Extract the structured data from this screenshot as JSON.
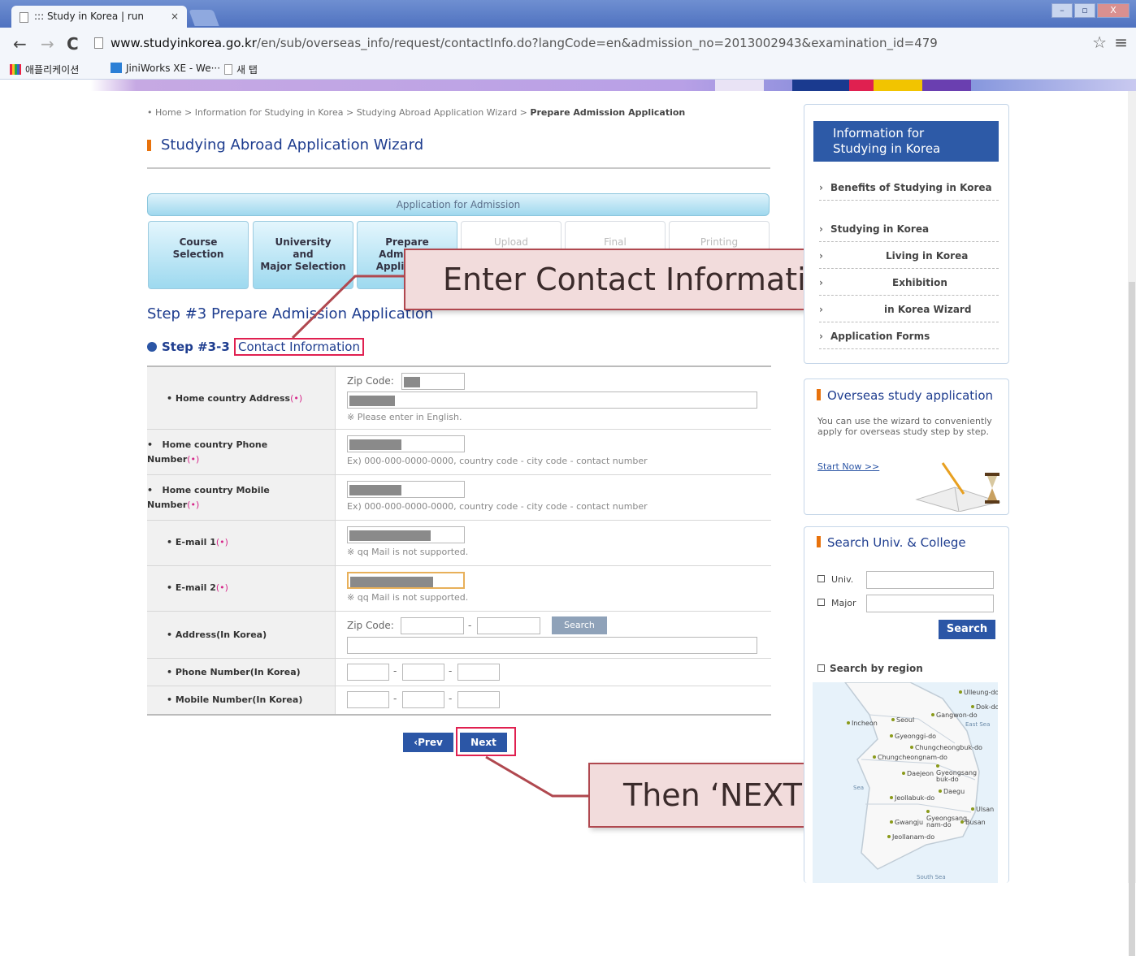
{
  "browser": {
    "tab_title": "::: Study in Korea | run",
    "tab_close": "×",
    "url_domain": "www.studyinkorea.go.kr",
    "url_path": "/en/sub/overseas_info/request/contactInfo.do?langCode=en&admission_no=2013002943&examination_id=479",
    "bookmarks": [
      "애플리케이션",
      "JiniWorks XE - We···",
      "새 탭"
    ],
    "minimize": "–",
    "maximize": "▫",
    "close": "X"
  },
  "breadcrumb": {
    "items": [
      "Home",
      "Information for Studying in Korea",
      "Studying Abroad Application Wizard"
    ],
    "current": "Prepare Admission Application"
  },
  "page_title": "Studying Abroad Application Wizard",
  "wizard": {
    "bar_label": "Application for Admission",
    "steps": [
      {
        "label": "Course\nSelection",
        "active": true
      },
      {
        "label": "University\nand\nMajor Selection",
        "active": true
      },
      {
        "label": "Prepare\nAdmission\nApplication",
        "active": true
      },
      {
        "label": "Upload",
        "active": false
      },
      {
        "label": "Final",
        "active": false
      },
      {
        "label": "Printing",
        "active": false
      }
    ]
  },
  "step_heading": "Step #3 Prepare Admission Application",
  "substep": {
    "prefix": "Step #3-3",
    "highlight": "Contact Information"
  },
  "form": {
    "home_address_label": "Home country Address",
    "req_mark": "(•)",
    "zip_code_label": "Zip Code:",
    "english_hint": "※ Please enter in English.",
    "home_phone_label": "Home country Phone Number",
    "home_mobile_label": "Home country Mobile Number",
    "phone_hint": "Ex) 000-000-0000-0000, country code - city code - contact number",
    "email1_label": "E-mail 1",
    "email2_label": "E-mail 2",
    "qq_hint": "※ qq Mail is not supported.",
    "korea_address_label": "Address(In Korea)",
    "search_label": "Search",
    "korea_phone_label": "Phone Number(In Korea)",
    "korea_mobile_label": "Mobile Number(In Korea)",
    "dash": "-"
  },
  "buttons": {
    "prev": "‹Prev",
    "next": "Next"
  },
  "callouts": {
    "contact": "Enter Contact Information",
    "next": "Then ‘NEXT’"
  },
  "sidebar": {
    "info_title": "Information for\nStudying in Korea",
    "info_items": [
      "Benefits of Studying in Korea",
      "Studying in Korea",
      "Living in Korea",
      "Exhibition",
      "in Korea Wizard",
      "Application Forms"
    ],
    "overseas_title": "Overseas study application",
    "overseas_desc": "You can use the wizard to conveniently apply for overseas study step by step.",
    "start_now": "Start Now >>",
    "search_title": "Search Univ. & College",
    "univ_label": "Univ.",
    "major_label": "Major",
    "search_btn": "Search",
    "region_label": "Search by region",
    "regions": [
      "Ulleung-do",
      "Dok-do",
      "Gangwon-do",
      "Seoul",
      "Incheon",
      "East Sea",
      "Gyeonggi-do",
      "Chungcheongbuk-do",
      "Chungcheongnam-do",
      "Gyeongsang buk-do",
      "Daejeon",
      "Sea",
      "Daegu",
      "Jeollabuk-do",
      "Ulsan",
      "Gyeongsang nam-do",
      "Gwangju",
      "Busan",
      "Jeollanam-do",
      "South Sea"
    ]
  },
  "colors": {
    "accent": "#2b56a6",
    "highlight": "#e02050",
    "callout_border": "#b0484f"
  }
}
